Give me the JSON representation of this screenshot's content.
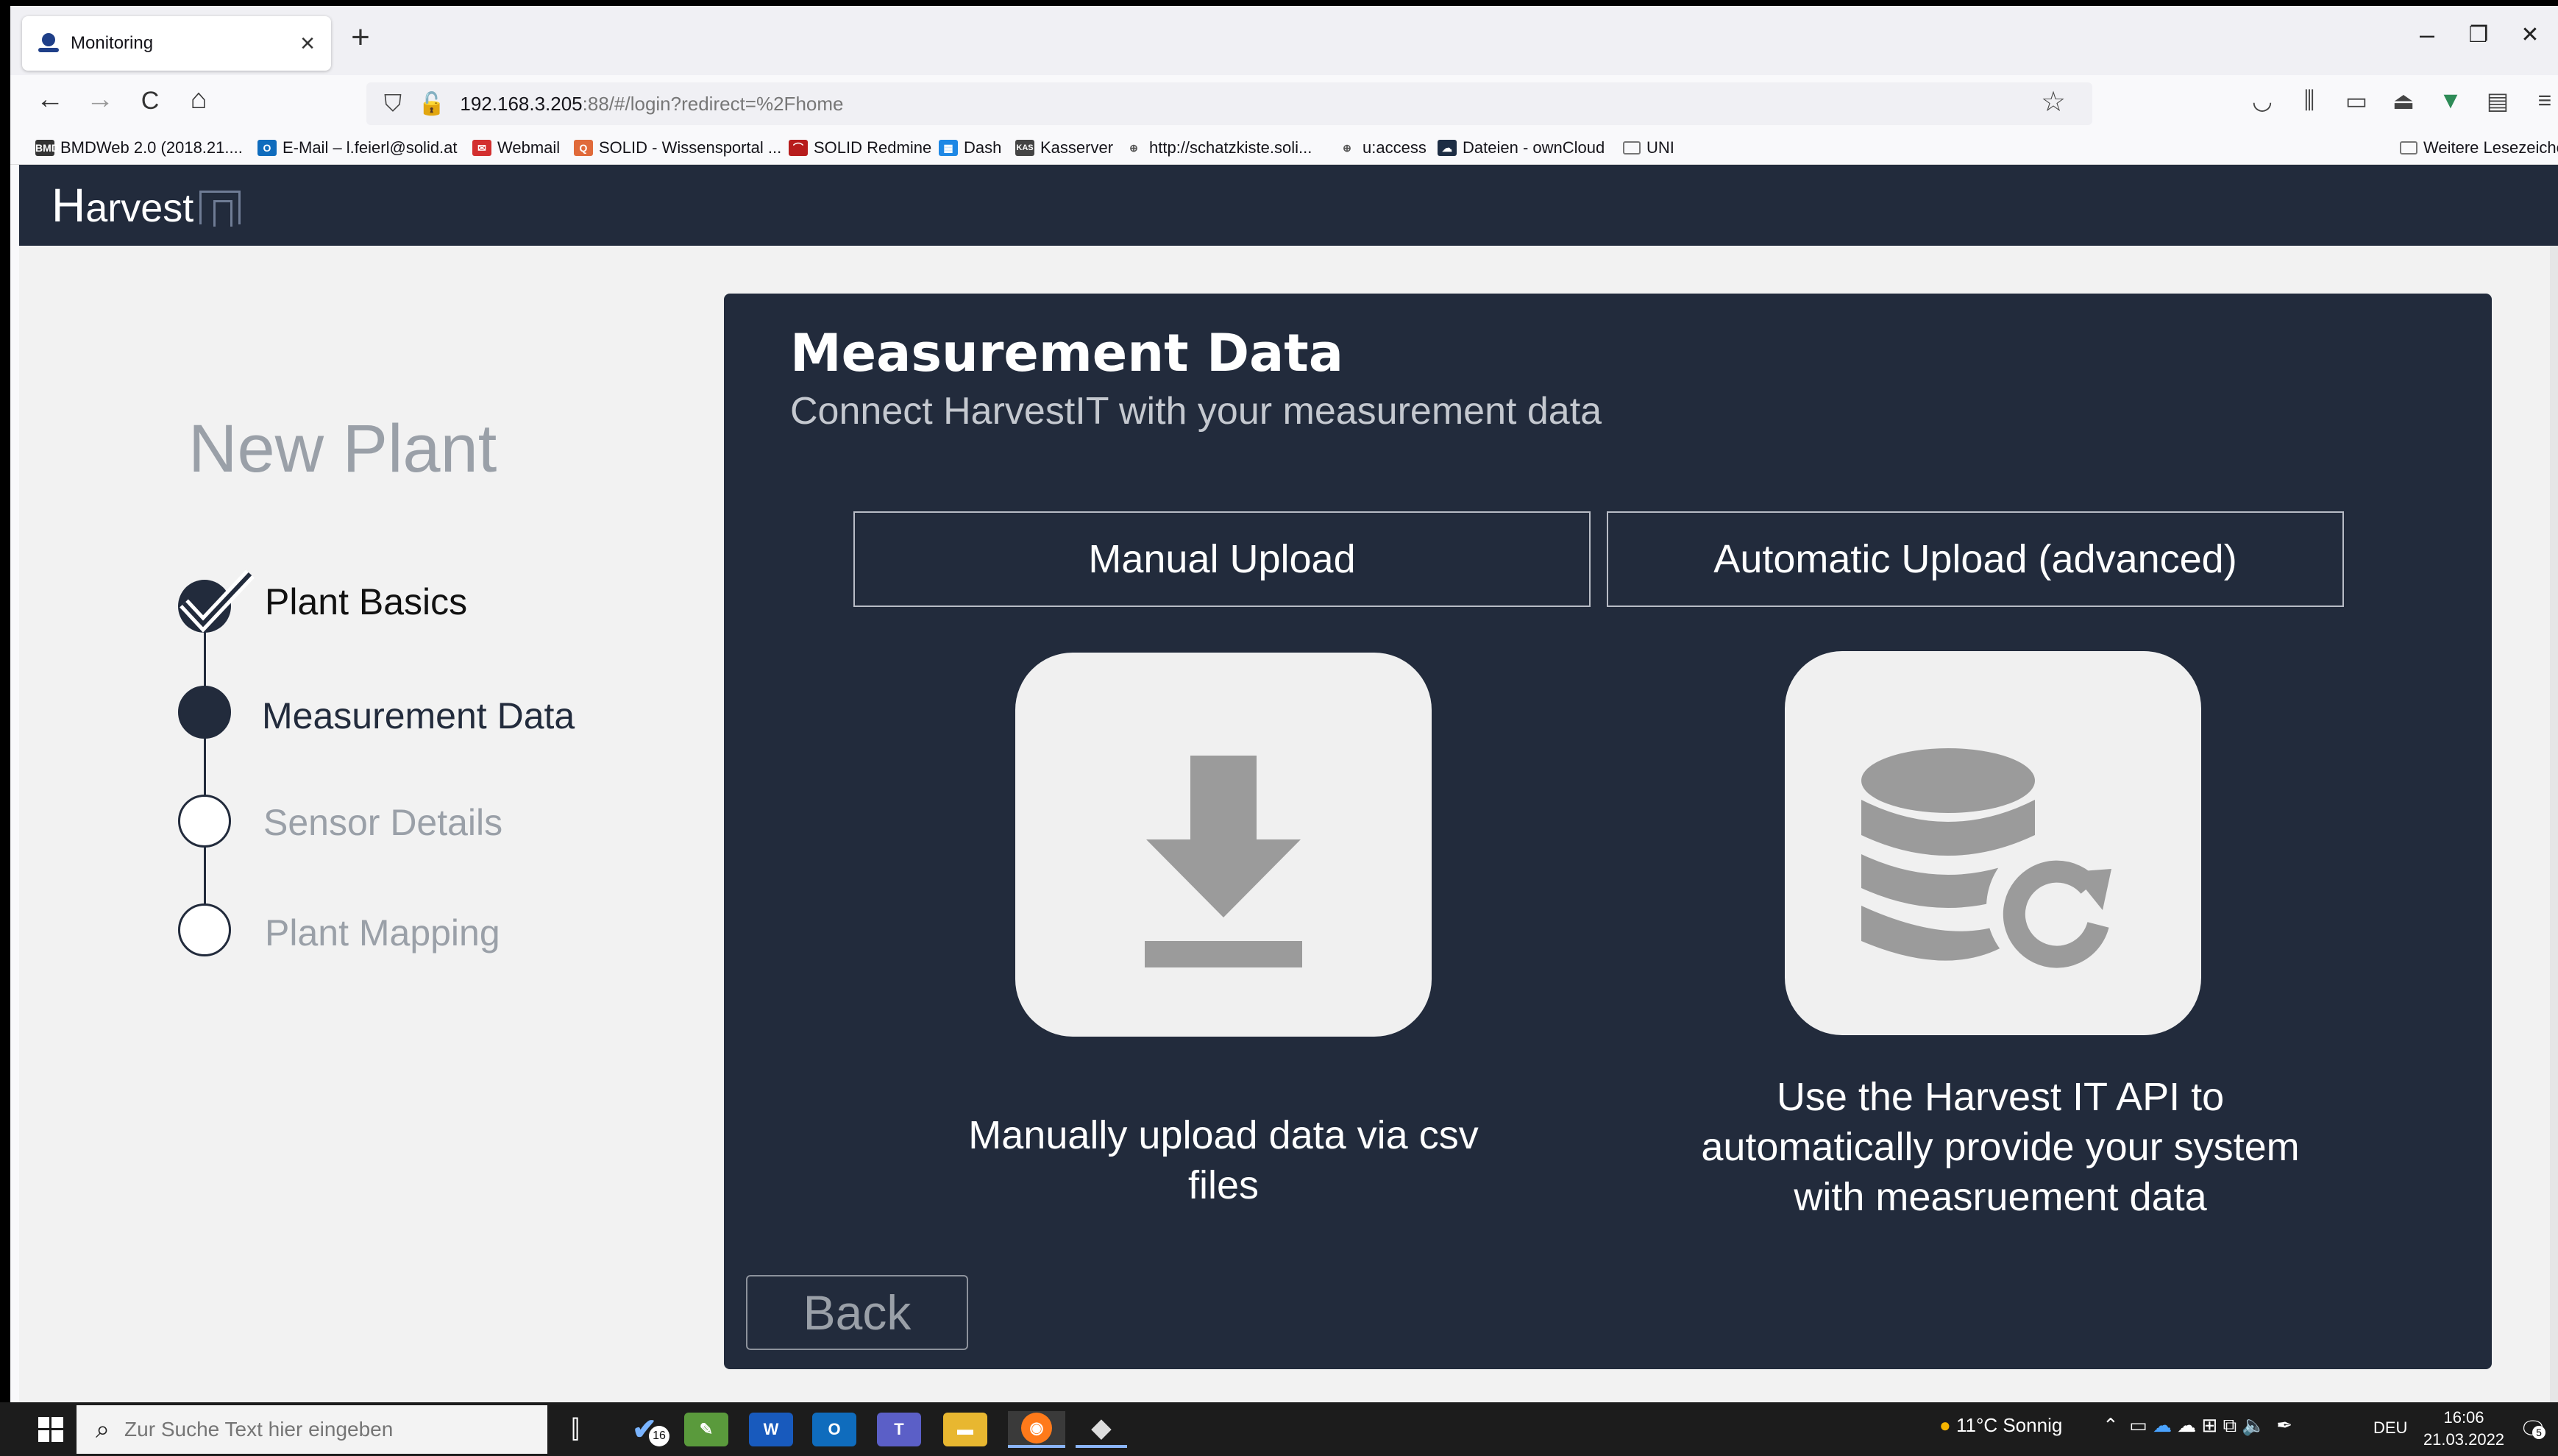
{
  "browser": {
    "tab_title": "Monitoring",
    "tab_close": "×",
    "new_tab": "+",
    "url_host": "192.168.3.205",
    "url_path": ":88/#/login?redirect=%2Fhome",
    "window_controls": [
      "–",
      "❐",
      "✕"
    ],
    "nav": {
      "back": "←",
      "forward": "→",
      "reload": "C",
      "home": "⌂"
    },
    "bookmarks": [
      {
        "label": "BMDWeb 2.0 (2018.21....",
        "icon": "BMD",
        "color": "#333333"
      },
      {
        "label": "E-Mail – l.feierl@solid.at",
        "icon": "O",
        "color": "#0f6cbd"
      },
      {
        "label": "Webmail",
        "icon": "✉",
        "color": "#d32f2f"
      },
      {
        "label": "SOLID - Wissensportal ...",
        "icon": "Q",
        "color": "#e06a3a"
      },
      {
        "label": "SOLID Redmine",
        "icon": "⌒",
        "color": "#b71c1c"
      },
      {
        "label": "Dash",
        "icon": "▦",
        "color": "#1e88e5"
      },
      {
        "label": "Kasserver",
        "icon": "KAS",
        "color": "#444444"
      },
      {
        "label": "http://schatzkiste.soli...",
        "icon": "🌐",
        "color": "#666666"
      },
      {
        "label": "u:access",
        "icon": "🌐",
        "color": "#666666"
      },
      {
        "label": "Dateien - ownCloud",
        "icon": "☁",
        "color": "#1d2d44"
      },
      {
        "label": "UNI",
        "icon": "📁",
        "color": "#888888"
      }
    ],
    "other_bookmarks": "Weitere Lesezeichen"
  },
  "app": {
    "logo_initial": "H",
    "logo_rest": "arvest"
  },
  "wizard": {
    "title": "New Plant",
    "steps": [
      {
        "label": "Plant Basics",
        "state": "done"
      },
      {
        "label": "Measurement Data",
        "state": "current"
      },
      {
        "label": "Sensor Details",
        "state": "pending"
      },
      {
        "label": "Plant Mapping",
        "state": "pending"
      }
    ]
  },
  "panel": {
    "title": "Measurement Data",
    "subtitle": "Connect HarvestIT with your measurement data",
    "manual_button": "Manual Upload",
    "auto_button": "Automatic Upload (advanced)",
    "manual_desc": "Manually upload data via csv files",
    "auto_desc": "Use the Harvest IT API to automatically provide your system with measruement data",
    "back_button": "Back",
    "manual_icon": "download-icon",
    "auto_icon": "database-sync-icon"
  },
  "taskbar": {
    "search_placeholder": "Zur Suche Text hier eingeben",
    "todo_badge": "16",
    "weather": "11°C  Sonnig",
    "language": "DEU",
    "time": "16:06",
    "date": "21.03.2022",
    "notification_count": "5"
  },
  "colors": {
    "app_dark": "#222b3c",
    "content_bg": "#f2f2f2",
    "muted_text": "#9aa0a8"
  }
}
